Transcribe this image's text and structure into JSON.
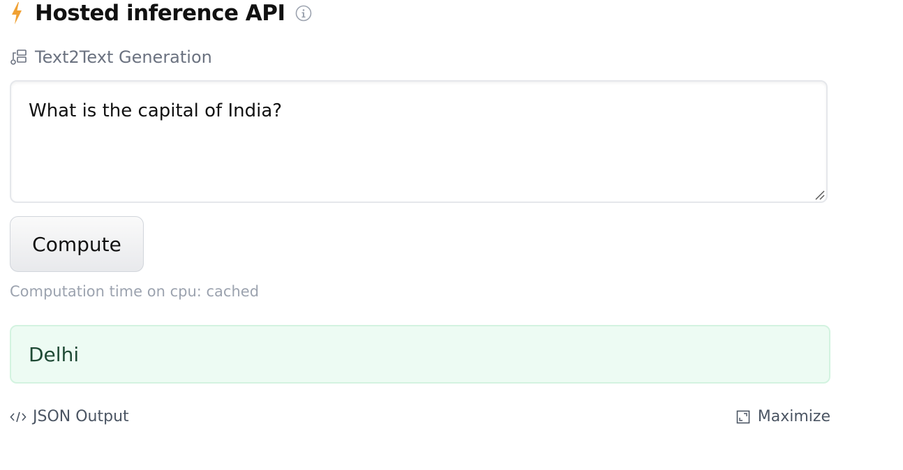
{
  "header": {
    "title": "Hosted inference API",
    "bolt_icon": "lightning-bolt-icon",
    "info_icon": "info-icon",
    "bolt_color": "#f0a133"
  },
  "task": {
    "icon": "text2text-icon",
    "label": "Text2Text Generation"
  },
  "input": {
    "value": "What is the capital of India?"
  },
  "compute_button": {
    "label": "Compute"
  },
  "computation_time": {
    "text": "Computation time on cpu: cached"
  },
  "output": {
    "value": "Delhi",
    "background_color": "#edfbf3"
  },
  "footer": {
    "json_label": "JSON Output",
    "json_icon": "code-icon",
    "maximize_label": "Maximize",
    "maximize_icon": "maximize-icon"
  }
}
